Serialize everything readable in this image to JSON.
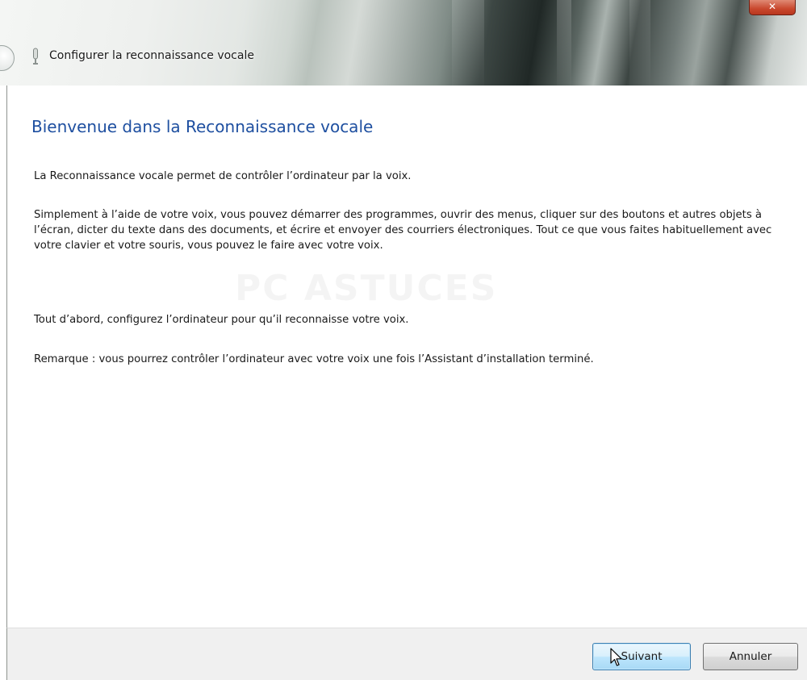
{
  "window": {
    "title": "Configurer la reconnaissance vocale",
    "close_glyph": "✕"
  },
  "main": {
    "heading": "Bienvenue dans la Reconnaissance vocale",
    "paragraphs": [
      "La Reconnaissance vocale permet de contrôler l’ordinateur par la voix.",
      "Simplement à l’aide de votre voix, vous pouvez démarrer des programmes, ouvrir des menus, cliquer sur des boutons et autres objets à l’écran, dicter du texte dans des documents, et écrire et envoyer des courriers électroniques. Tout ce que vous faites habituellement avec votre clavier et votre souris, vous pouvez le faire avec votre voix.",
      "Tout d’abord, configurez l’ordinateur pour qu’il reconnaisse votre voix.",
      "Remarque : vous pourrez contrôler l’ordinateur avec votre voix une fois l’Assistant d’installation terminé."
    ],
    "watermark": "PC ASTUCES"
  },
  "footer": {
    "next_label": "Suivant",
    "cancel_label": "Annuler"
  },
  "icons": {
    "back": "back-arrow-icon",
    "app": "microphone-icon",
    "close": "close-icon",
    "cursor": "mouse-cursor-icon"
  },
  "colors": {
    "heading": "#1e4fa0",
    "next_button_border": "#3c7fb1",
    "footer_bg": "#f0f0f0"
  }
}
